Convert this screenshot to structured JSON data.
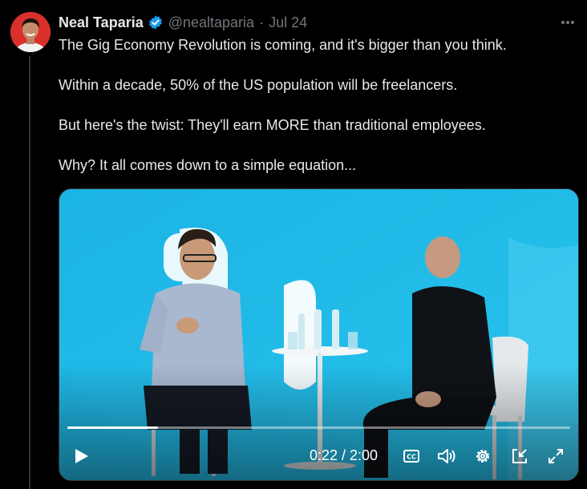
{
  "tweet": {
    "author_name": "Neal Taparia",
    "handle": "@nealtaparia",
    "separator": "·",
    "date": "Jul 24",
    "paragraphs": [
      "The Gig Economy Revolution is coming, and it's bigger than you think.",
      "Within a decade, 50% of the US population will be freelancers.",
      "But here's the twist: They'll earn MORE than traditional employees.",
      "Why? It all comes down to a simple equation..."
    ]
  },
  "video": {
    "time_display": "0:22 / 2:00",
    "progress_fraction": 0.18
  },
  "icons": {
    "verified": "verified-badge-icon",
    "more": "more-options-icon",
    "play": "play-icon",
    "captions": "closed-captions-icon",
    "volume": "volume-icon",
    "settings": "settings-gear-icon",
    "pip": "picture-in-picture-icon",
    "fullscreen": "fullscreen-icon"
  },
  "colors": {
    "background": "#000000",
    "text": "#e7e9ea",
    "muted": "#71767b",
    "verified_blue": "#1d9bf0",
    "video_bg": "#1fb7e6"
  }
}
